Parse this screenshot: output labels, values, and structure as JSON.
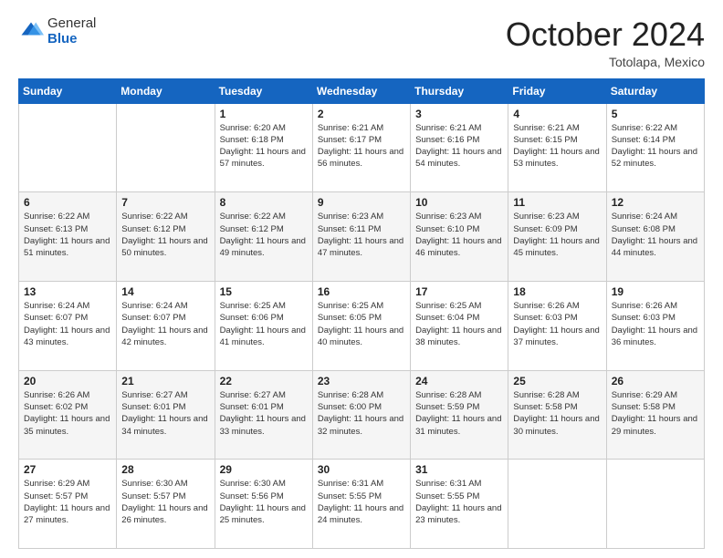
{
  "header": {
    "logo_general": "General",
    "logo_blue": "Blue",
    "month_title": "October 2024",
    "location": "Totolapa, Mexico"
  },
  "days_of_week": [
    "Sunday",
    "Monday",
    "Tuesday",
    "Wednesday",
    "Thursday",
    "Friday",
    "Saturday"
  ],
  "weeks": [
    [
      {
        "day": "",
        "sunrise": "",
        "sunset": "",
        "daylight": ""
      },
      {
        "day": "",
        "sunrise": "",
        "sunset": "",
        "daylight": ""
      },
      {
        "day": "1",
        "sunrise": "Sunrise: 6:20 AM",
        "sunset": "Sunset: 6:18 PM",
        "daylight": "Daylight: 11 hours and 57 minutes."
      },
      {
        "day": "2",
        "sunrise": "Sunrise: 6:21 AM",
        "sunset": "Sunset: 6:17 PM",
        "daylight": "Daylight: 11 hours and 56 minutes."
      },
      {
        "day": "3",
        "sunrise": "Sunrise: 6:21 AM",
        "sunset": "Sunset: 6:16 PM",
        "daylight": "Daylight: 11 hours and 54 minutes."
      },
      {
        "day": "4",
        "sunrise": "Sunrise: 6:21 AM",
        "sunset": "Sunset: 6:15 PM",
        "daylight": "Daylight: 11 hours and 53 minutes."
      },
      {
        "day": "5",
        "sunrise": "Sunrise: 6:22 AM",
        "sunset": "Sunset: 6:14 PM",
        "daylight": "Daylight: 11 hours and 52 minutes."
      }
    ],
    [
      {
        "day": "6",
        "sunrise": "Sunrise: 6:22 AM",
        "sunset": "Sunset: 6:13 PM",
        "daylight": "Daylight: 11 hours and 51 minutes."
      },
      {
        "day": "7",
        "sunrise": "Sunrise: 6:22 AM",
        "sunset": "Sunset: 6:12 PM",
        "daylight": "Daylight: 11 hours and 50 minutes."
      },
      {
        "day": "8",
        "sunrise": "Sunrise: 6:22 AM",
        "sunset": "Sunset: 6:12 PM",
        "daylight": "Daylight: 11 hours and 49 minutes."
      },
      {
        "day": "9",
        "sunrise": "Sunrise: 6:23 AM",
        "sunset": "Sunset: 6:11 PM",
        "daylight": "Daylight: 11 hours and 47 minutes."
      },
      {
        "day": "10",
        "sunrise": "Sunrise: 6:23 AM",
        "sunset": "Sunset: 6:10 PM",
        "daylight": "Daylight: 11 hours and 46 minutes."
      },
      {
        "day": "11",
        "sunrise": "Sunrise: 6:23 AM",
        "sunset": "Sunset: 6:09 PM",
        "daylight": "Daylight: 11 hours and 45 minutes."
      },
      {
        "day": "12",
        "sunrise": "Sunrise: 6:24 AM",
        "sunset": "Sunset: 6:08 PM",
        "daylight": "Daylight: 11 hours and 44 minutes."
      }
    ],
    [
      {
        "day": "13",
        "sunrise": "Sunrise: 6:24 AM",
        "sunset": "Sunset: 6:07 PM",
        "daylight": "Daylight: 11 hours and 43 minutes."
      },
      {
        "day": "14",
        "sunrise": "Sunrise: 6:24 AM",
        "sunset": "Sunset: 6:07 PM",
        "daylight": "Daylight: 11 hours and 42 minutes."
      },
      {
        "day": "15",
        "sunrise": "Sunrise: 6:25 AM",
        "sunset": "Sunset: 6:06 PM",
        "daylight": "Daylight: 11 hours and 41 minutes."
      },
      {
        "day": "16",
        "sunrise": "Sunrise: 6:25 AM",
        "sunset": "Sunset: 6:05 PM",
        "daylight": "Daylight: 11 hours and 40 minutes."
      },
      {
        "day": "17",
        "sunrise": "Sunrise: 6:25 AM",
        "sunset": "Sunset: 6:04 PM",
        "daylight": "Daylight: 11 hours and 38 minutes."
      },
      {
        "day": "18",
        "sunrise": "Sunrise: 6:26 AM",
        "sunset": "Sunset: 6:03 PM",
        "daylight": "Daylight: 11 hours and 37 minutes."
      },
      {
        "day": "19",
        "sunrise": "Sunrise: 6:26 AM",
        "sunset": "Sunset: 6:03 PM",
        "daylight": "Daylight: 11 hours and 36 minutes."
      }
    ],
    [
      {
        "day": "20",
        "sunrise": "Sunrise: 6:26 AM",
        "sunset": "Sunset: 6:02 PM",
        "daylight": "Daylight: 11 hours and 35 minutes."
      },
      {
        "day": "21",
        "sunrise": "Sunrise: 6:27 AM",
        "sunset": "Sunset: 6:01 PM",
        "daylight": "Daylight: 11 hours and 34 minutes."
      },
      {
        "day": "22",
        "sunrise": "Sunrise: 6:27 AM",
        "sunset": "Sunset: 6:01 PM",
        "daylight": "Daylight: 11 hours and 33 minutes."
      },
      {
        "day": "23",
        "sunrise": "Sunrise: 6:28 AM",
        "sunset": "Sunset: 6:00 PM",
        "daylight": "Daylight: 11 hours and 32 minutes."
      },
      {
        "day": "24",
        "sunrise": "Sunrise: 6:28 AM",
        "sunset": "Sunset: 5:59 PM",
        "daylight": "Daylight: 11 hours and 31 minutes."
      },
      {
        "day": "25",
        "sunrise": "Sunrise: 6:28 AM",
        "sunset": "Sunset: 5:58 PM",
        "daylight": "Daylight: 11 hours and 30 minutes."
      },
      {
        "day": "26",
        "sunrise": "Sunrise: 6:29 AM",
        "sunset": "Sunset: 5:58 PM",
        "daylight": "Daylight: 11 hours and 29 minutes."
      }
    ],
    [
      {
        "day": "27",
        "sunrise": "Sunrise: 6:29 AM",
        "sunset": "Sunset: 5:57 PM",
        "daylight": "Daylight: 11 hours and 27 minutes."
      },
      {
        "day": "28",
        "sunrise": "Sunrise: 6:30 AM",
        "sunset": "Sunset: 5:57 PM",
        "daylight": "Daylight: 11 hours and 26 minutes."
      },
      {
        "day": "29",
        "sunrise": "Sunrise: 6:30 AM",
        "sunset": "Sunset: 5:56 PM",
        "daylight": "Daylight: 11 hours and 25 minutes."
      },
      {
        "day": "30",
        "sunrise": "Sunrise: 6:31 AM",
        "sunset": "Sunset: 5:55 PM",
        "daylight": "Daylight: 11 hours and 24 minutes."
      },
      {
        "day": "31",
        "sunrise": "Sunrise: 6:31 AM",
        "sunset": "Sunset: 5:55 PM",
        "daylight": "Daylight: 11 hours and 23 minutes."
      },
      {
        "day": "",
        "sunrise": "",
        "sunset": "",
        "daylight": ""
      },
      {
        "day": "",
        "sunrise": "",
        "sunset": "",
        "daylight": ""
      }
    ]
  ]
}
